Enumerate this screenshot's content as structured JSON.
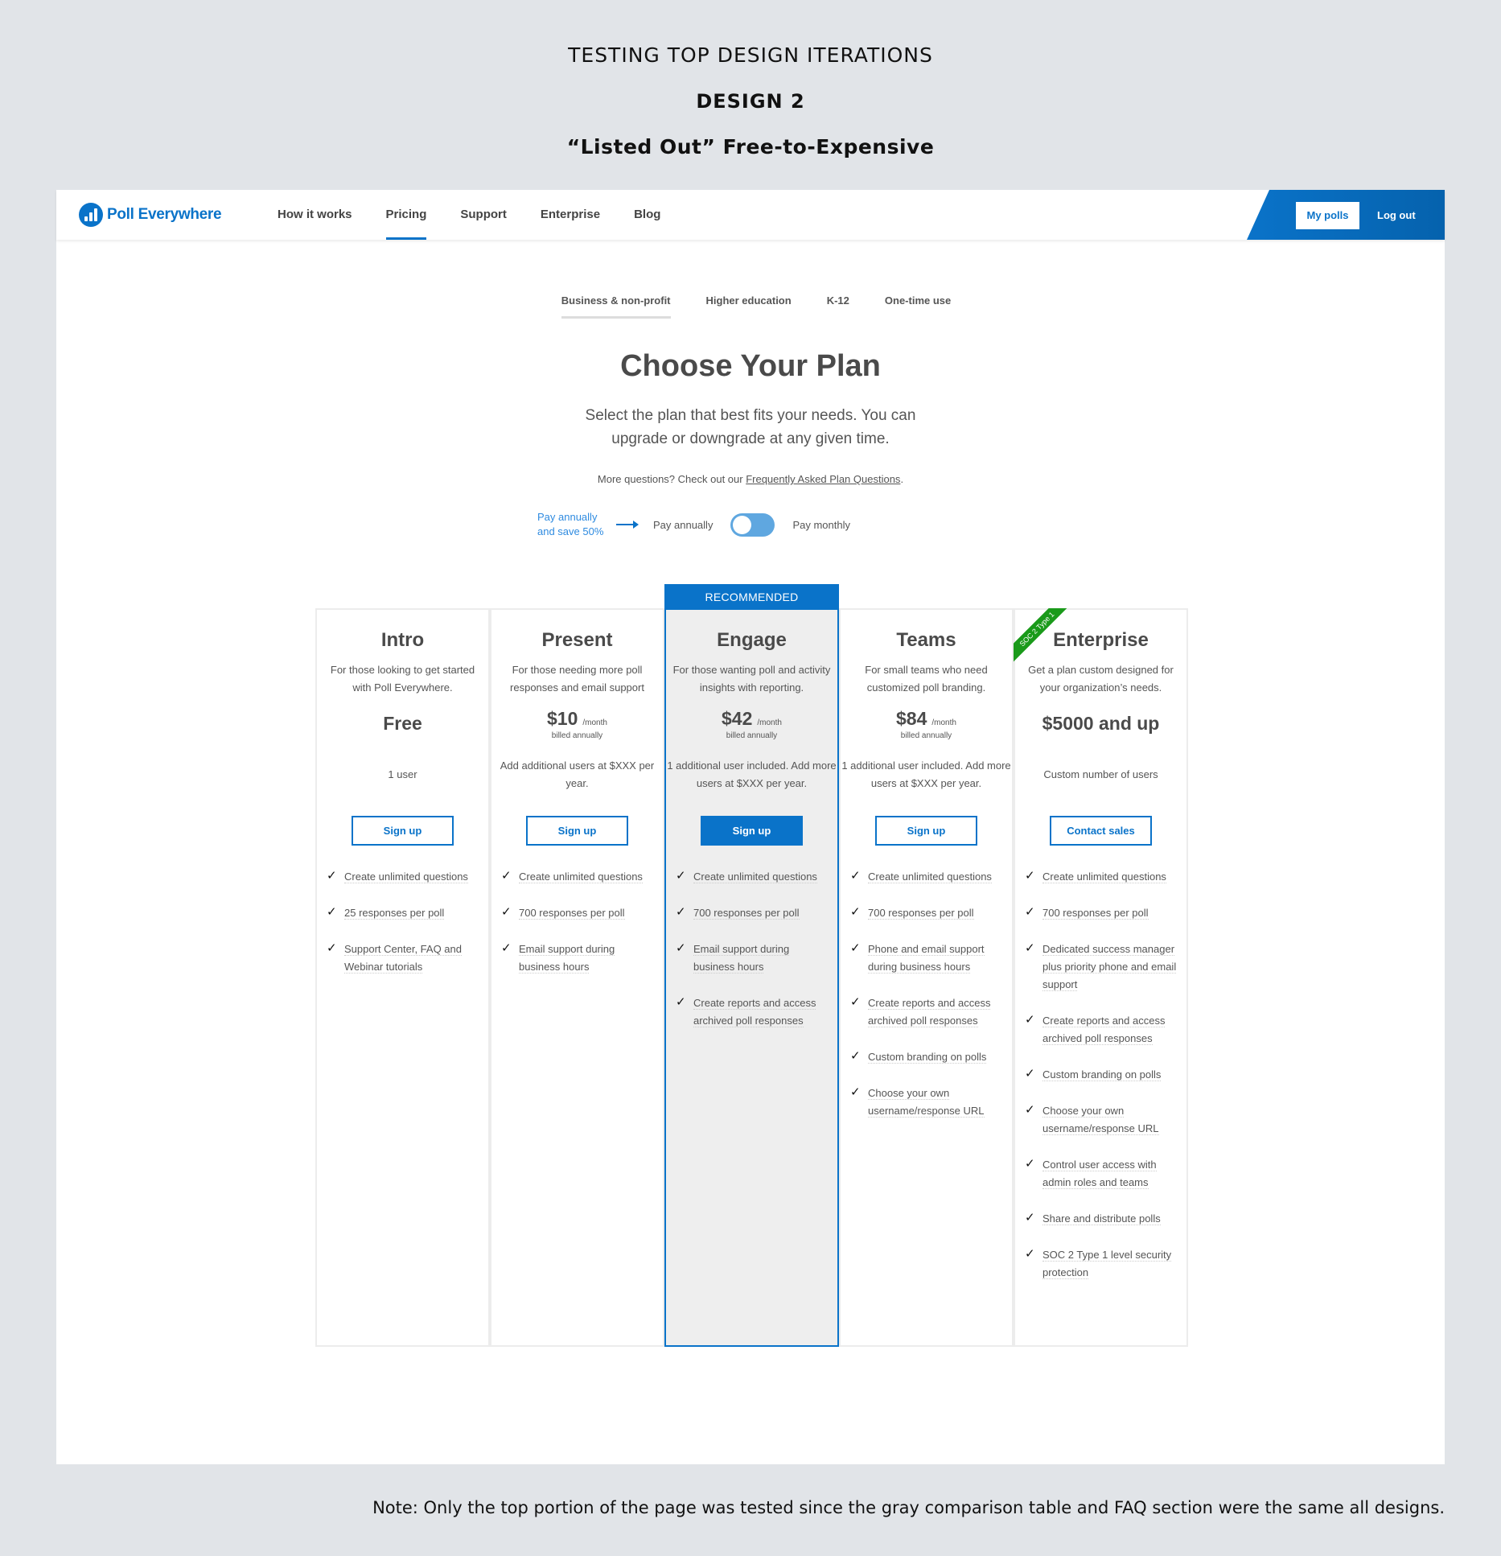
{
  "doc": {
    "heading": "TESTING TOP DESIGN ITERATIONS",
    "design_label": "DESIGN 2",
    "design_name": "“Listed Out” Free-to-Expensive",
    "footnote": "Note: Only the top portion of the page was tested since the gray comparison table and FAQ section were the same all designs."
  },
  "nav": {
    "brand": "Poll Everywhere",
    "links": [
      "How it works",
      "Pricing",
      "Support",
      "Enterprise",
      "Blog"
    ],
    "active_link": "Pricing",
    "my_polls": "My polls",
    "log_out": "Log out"
  },
  "segments": {
    "tabs": [
      "Business & non-profit",
      "Higher education",
      "K-12",
      "One-time use"
    ],
    "active": "Business & non-profit"
  },
  "hero": {
    "title": "Choose Your Plan",
    "subtitle_1": "Select the plan that best fits your needs. You can",
    "subtitle_2": "upgrade or downgrade at any given time.",
    "faq_prefix": "More questions? Check out our ",
    "faq_link": "Frequently Asked Plan Questions",
    "faq_suffix": "."
  },
  "billing": {
    "save_note_1": "Pay annually",
    "save_note_2": "and save 50%",
    "annual_label": "Pay annually",
    "monthly_label": "Pay monthly",
    "selected": "annual"
  },
  "colors": {
    "brand": "#0a73c9",
    "recommended_bg": "#eeeeee",
    "soc_badge": "#1a9a1a"
  },
  "plans": [
    {
      "name": "Intro",
      "desc": "For those looking to get started with Poll Everywhere.",
      "price": "Free",
      "users": "1 user",
      "cta": "Sign up",
      "features": [
        "Create unlimited questions",
        "25 responses per poll",
        "Support Center, FAQ and Webinar tutorials"
      ]
    },
    {
      "name": "Present",
      "desc": "For those needing more poll responses and email support",
      "price": "$10",
      "per": "/month",
      "billed": "billed annually",
      "users": "Add additional users at $XXX per year.",
      "cta": "Sign up",
      "features": [
        "Create unlimited questions",
        "700 responses per poll",
        "Email support during business hours"
      ]
    },
    {
      "name": "Engage",
      "badge": "RECOMMENDED",
      "desc": "For those wanting poll and activity insights with reporting.",
      "price": "$42",
      "per": "/month",
      "billed": "billed annually",
      "users": "1 additional user included. Add more users at $XXX per year.",
      "cta": "Sign up",
      "features": [
        "Create unlimited questions",
        "700 responses per poll",
        "Email support during business hours",
        "Create reports and access archived poll responses"
      ]
    },
    {
      "name": "Teams",
      "desc": "For small teams who need customized poll branding.",
      "price": "$84",
      "per": "/month",
      "billed": "billed annually",
      "users": "1 additional user included. Add more users at $XXX per year.",
      "cta": "Sign up",
      "features": [
        "Create unlimited questions",
        "700 responses per poll",
        "Phone and email support during business hours",
        "Create reports and access archived poll responses",
        "Custom branding on polls",
        "Choose your own username/response URL"
      ]
    },
    {
      "name": "Enterprise",
      "ribbon": "SOC 2 Type 1",
      "desc": "Get a plan custom designed for your organization’s needs.",
      "price": "$5000 and up",
      "users": "Custom number of users",
      "cta": "Contact sales",
      "features": [
        "Create unlimited questions",
        "700 responses per poll",
        "Dedicated success manager plus priority phone and email support",
        "Create reports and access archived poll responses",
        "Custom branding on polls",
        "Choose your own username/response URL",
        "Control user access with admin roles and teams",
        "Share and distribute polls",
        "SOC 2 Type 1 level security protection"
      ]
    }
  ]
}
